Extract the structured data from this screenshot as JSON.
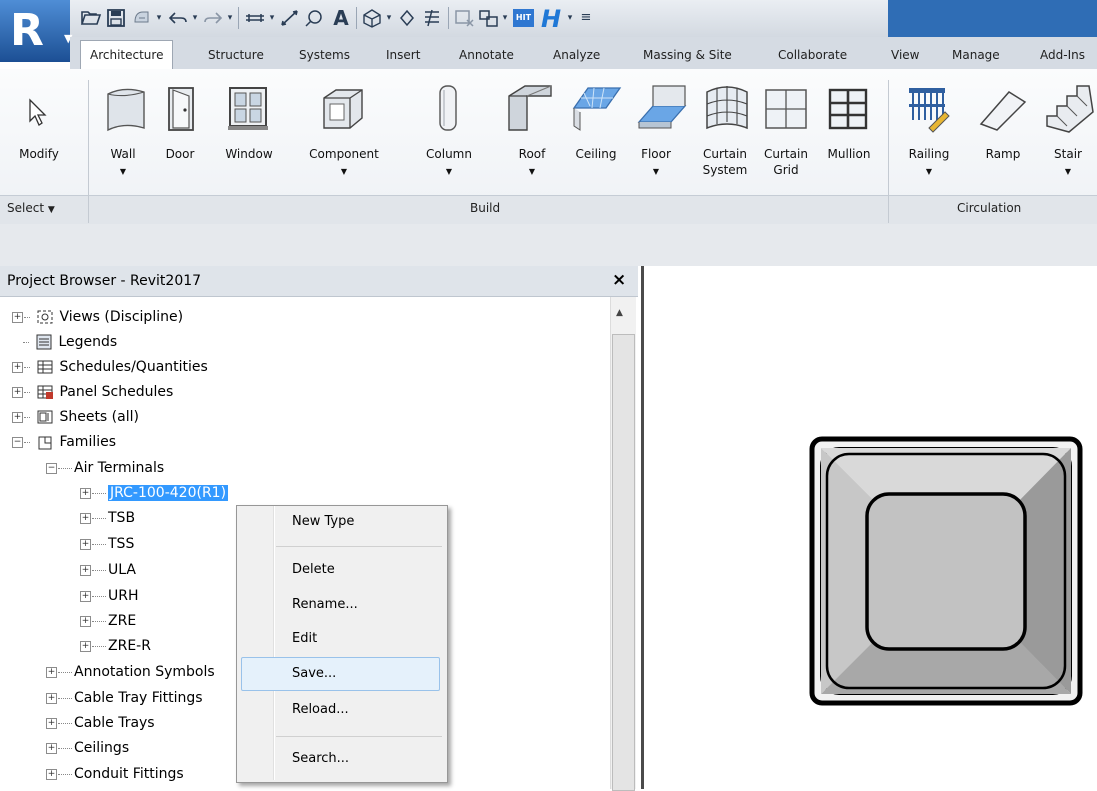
{
  "app": {
    "logo_letter": "R"
  },
  "quick_access": {
    "icons": [
      "open-icon",
      "save-icon",
      "sync-icon",
      "undo-icon",
      "redo-icon",
      "measure-icon",
      "dimension-icon",
      "tag-icon",
      "text-icon",
      "3d-view-icon",
      "section-icon",
      "thin-lines-icon",
      "close-hidden-icon",
      "switch-windows-icon",
      "hit-icon",
      "h-icon",
      "customize-icon"
    ],
    "text_label": "A",
    "hit_label": "HIT",
    "h_label": "H"
  },
  "tabs": [
    "Architecture",
    "Structure",
    "Systems",
    "Insert",
    "Annotate",
    "Analyze",
    "Massing & Site",
    "Collaborate",
    "View",
    "Manage",
    "Add-Ins"
  ],
  "ribbon": {
    "modify": {
      "label": "Modify"
    },
    "build": [
      {
        "label": "Wall",
        "dropdown": true
      },
      {
        "label": "Door",
        "dropdown": false
      },
      {
        "label": "Window",
        "dropdown": false
      },
      {
        "label": "Component",
        "dropdown": true
      },
      {
        "label": "Column",
        "dropdown": true
      },
      {
        "label": "Roof",
        "dropdown": true
      },
      {
        "label": "Ceiling",
        "dropdown": false
      },
      {
        "label": "Floor",
        "dropdown": true
      },
      {
        "label": "Curtain",
        "label2": "System",
        "dropdown": false
      },
      {
        "label": "Curtain",
        "label2": "Grid",
        "dropdown": false
      },
      {
        "label": "Mullion",
        "dropdown": false
      }
    ],
    "circulation": [
      {
        "label": "Railing",
        "dropdown": true
      },
      {
        "label": "Ramp",
        "dropdown": false
      },
      {
        "label": "Stair",
        "dropdown": true
      }
    ],
    "panels": {
      "select": "Select",
      "build": "Build",
      "circulation": "Circulation"
    }
  },
  "project_browser": {
    "title": "Project Browser - Revit2017",
    "close": "×",
    "tree": [
      {
        "label": "Views (Discipline)",
        "level": 0,
        "expander": "+",
        "icon": "views-icon"
      },
      {
        "label": "Legends",
        "level": 0,
        "expander": "",
        "icon": "legends-icon"
      },
      {
        "label": "Schedules/Quantities",
        "level": 0,
        "expander": "+",
        "icon": "schedules-icon"
      },
      {
        "label": "Panel Schedules",
        "level": 0,
        "expander": "+",
        "icon": "panel-schedules-icon"
      },
      {
        "label": "Sheets (all)",
        "level": 0,
        "expander": "+",
        "icon": "sheets-icon"
      },
      {
        "label": "Families",
        "level": 0,
        "expander": "−",
        "icon": "families-icon"
      },
      {
        "label": "Air Terminals",
        "level": 1,
        "expander": "−"
      },
      {
        "label": "JRC-100-420(R1)",
        "level": 2,
        "expander": "+",
        "selected": true
      },
      {
        "label": "TSB",
        "level": 2,
        "expander": "+"
      },
      {
        "label": "TSS",
        "level": 2,
        "expander": "+"
      },
      {
        "label": "ULA",
        "level": 2,
        "expander": "+"
      },
      {
        "label": "URH",
        "level": 2,
        "expander": "+"
      },
      {
        "label": "ZRE",
        "level": 2,
        "expander": "+"
      },
      {
        "label": "ZRE-R",
        "level": 2,
        "expander": "+"
      },
      {
        "label": "Annotation Symbols",
        "level": 1,
        "expander": "+"
      },
      {
        "label": "Cable Tray Fittings",
        "level": 1,
        "expander": "+"
      },
      {
        "label": "Cable Trays",
        "level": 1,
        "expander": "+"
      },
      {
        "label": "Ceilings",
        "level": 1,
        "expander": "+"
      },
      {
        "label": "Conduit Fittings",
        "level": 1,
        "expander": "+"
      }
    ]
  },
  "context_menu": {
    "items": [
      "New Type",
      "Delete",
      "Rename...",
      "Edit",
      "Save...",
      "Reload...",
      "Search..."
    ],
    "hovered": "Save..."
  },
  "colors": {
    "selection": "#3399ff",
    "hover": "#e5f1fb",
    "accent": "#2f6db5"
  }
}
